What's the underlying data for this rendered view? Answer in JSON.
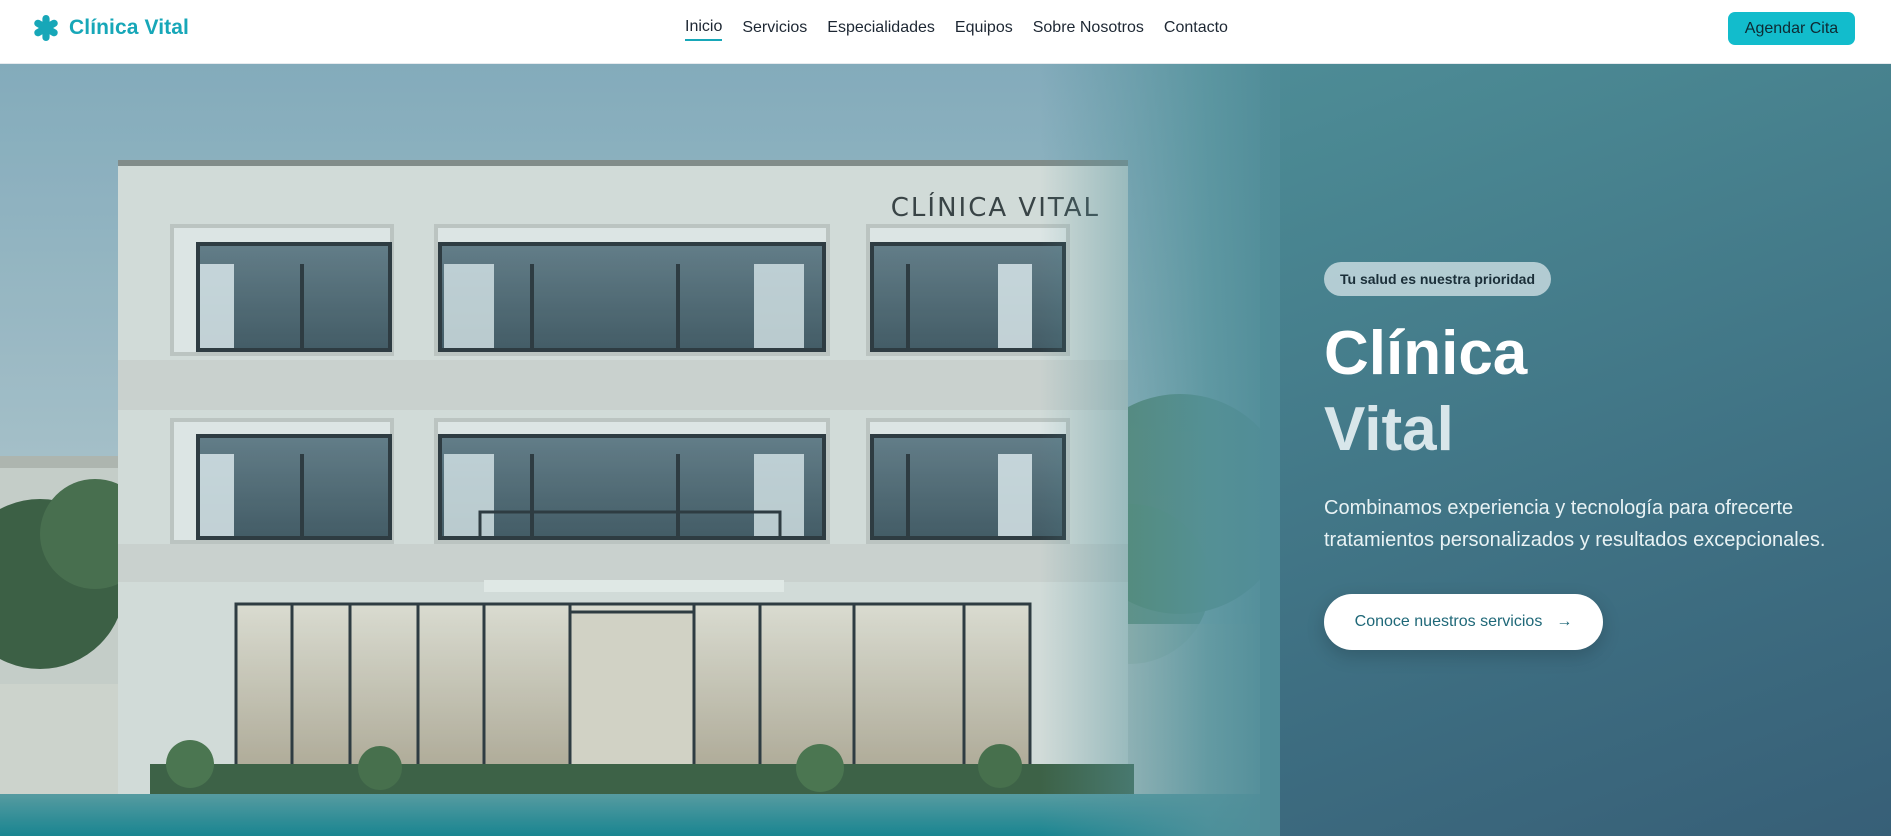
{
  "brand": {
    "name": "Clínica Vital",
    "icon": "medical-star-icon",
    "color": "#17a7b8"
  },
  "nav": {
    "items": [
      {
        "label": "Inicio",
        "active": true
      },
      {
        "label": "Servicios",
        "active": false
      },
      {
        "label": "Especialidades",
        "active": false
      },
      {
        "label": "Equipos",
        "active": false
      },
      {
        "label": "Sobre Nosotros",
        "active": false
      },
      {
        "label": "Contacto",
        "active": false
      }
    ],
    "cta_label": "Agendar Cita"
  },
  "hero": {
    "badge": "Tu salud es nuestra prioridad",
    "title_line1": "Clínica",
    "title_line2": "Vital",
    "subtitle": "Combinamos experiencia y tecnología para ofrecerte tratamientos personalizados y resultados excepcionales.",
    "cta_label": "Conoce nuestros servicios",
    "cta_icon": "arrow-right-icon",
    "image": {
      "description": "clinic-building-photo",
      "sign_text": "CLÍNICA VITAL"
    }
  },
  "colors": {
    "accent": "#12bccc",
    "hero_bg": "#4a8792",
    "text_dark": "#1d2733"
  }
}
